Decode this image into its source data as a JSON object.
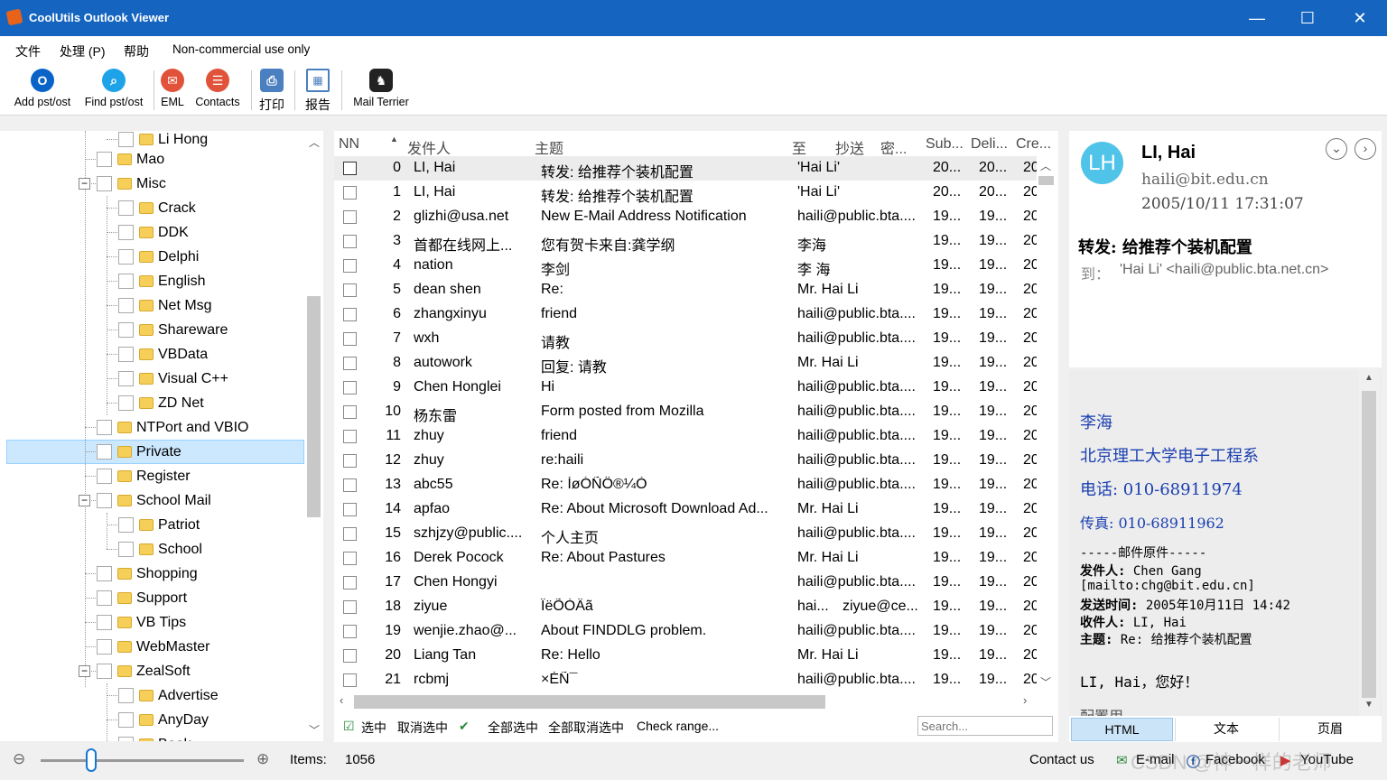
{
  "window": {
    "title": "CoolUtils Outlook Viewer",
    "min": "—",
    "max": "☐",
    "close": "✕"
  },
  "menu": [
    "文件",
    "处理 (P)",
    "帮助",
    "Non-commercial use only"
  ],
  "toolbar": [
    {
      "label": "Add pst/ost",
      "icon": "outlook-icon"
    },
    {
      "label": "Find pst/ost",
      "icon": "search-icon"
    },
    {
      "label": "EML",
      "icon": "email-icon"
    },
    {
      "label": "Contacts",
      "icon": "contacts-icon"
    },
    {
      "label": "打印",
      "icon": "print-icon"
    },
    {
      "label": "报告",
      "icon": "report-icon"
    },
    {
      "label": "Mail Terrier",
      "icon": "terrier-icon"
    }
  ],
  "tree": [
    {
      "label": "Li Hong"
    },
    {
      "label": "Mao"
    },
    {
      "label": "Misc",
      "expander": "−"
    },
    {
      "label": "Crack"
    },
    {
      "label": "DDK"
    },
    {
      "label": "Delphi"
    },
    {
      "label": "English"
    },
    {
      "label": "Net Msg"
    },
    {
      "label": "Shareware"
    },
    {
      "label": "VBData"
    },
    {
      "label": "Visual C++"
    },
    {
      "label": "ZD Net"
    },
    {
      "label": "NTPort and VBIO"
    },
    {
      "label": "Private",
      "selected": true
    },
    {
      "label": "Register"
    },
    {
      "label": "School Mail",
      "expander": "−"
    },
    {
      "label": "Patriot"
    },
    {
      "label": "School"
    },
    {
      "label": "Shopping"
    },
    {
      "label": "Support"
    },
    {
      "label": "VB Tips"
    },
    {
      "label": "WebMaster"
    },
    {
      "label": "ZealSoft",
      "expander": "−"
    },
    {
      "label": "Advertise"
    },
    {
      "label": "AnyDay"
    },
    {
      "label": "Book"
    }
  ],
  "list": {
    "headers": [
      "NN",
      "发件人",
      "主题",
      "至",
      "抄送",
      "密...",
      "Sub...",
      "Deli...",
      "Cre..."
    ],
    "rows": [
      [
        "0",
        "LI, Hai",
        "转发: 给推荐个装机配置",
        "'Hai Li'",
        "",
        "20...",
        "20...",
        "20"
      ],
      [
        "1",
        "LI, Hai",
        "转发: 给推荐个装机配置",
        "'Hai Li'",
        "",
        "20...",
        "20...",
        "20"
      ],
      [
        "2",
        "glizhi@usa.net",
        "New E-Mail Address Notification",
        "haili@public.bta....",
        "",
        "19...",
        "19...",
        "20"
      ],
      [
        "3",
        "首都在线网上...",
        "您有贺卡来自:龚学纲",
        "李海",
        "",
        "19...",
        "19...",
        "20"
      ],
      [
        "4",
        "nation",
        "李剑",
        "李 海",
        "",
        "19...",
        "19...",
        "20"
      ],
      [
        "5",
        "dean shen",
        "Re:",
        "Mr. Hai Li",
        "",
        "19...",
        "19...",
        "20"
      ],
      [
        "6",
        "zhangxinyu",
        "friend",
        "haili@public.bta....",
        "",
        "19...",
        "19...",
        "20"
      ],
      [
        "7",
        "wxh",
        "请教",
        "haili@public.bta....",
        "",
        "19...",
        "19...",
        "20"
      ],
      [
        "8",
        "autowork",
        "回复: 请教",
        "Mr. Hai Li",
        "",
        "19...",
        "19...",
        "20"
      ],
      [
        "9",
        "Chen Honglei",
        "Hi",
        "haili@public.bta....",
        "",
        "19...",
        "19...",
        "20"
      ],
      [
        "10",
        "杨东雷",
        "Form posted from Mozilla",
        "haili@public.bta....",
        "",
        "19...",
        "19...",
        "20"
      ],
      [
        "11",
        "zhuy",
        "friend",
        "haili@public.bta....",
        "",
        "19...",
        "19...",
        "20"
      ],
      [
        "12",
        "zhuy",
        "re:haili",
        "haili@public.bta....",
        "",
        "19...",
        "19...",
        "20"
      ],
      [
        "13",
        "abc55",
        "Re: ÍøÓÑÖ®¼Ò",
        "haili@public.bta....",
        "",
        "19...",
        "19...",
        "20"
      ],
      [
        "14",
        "apfao",
        "Re: About Microsoft Download Ad...",
        "Mr. Hai Li",
        "",
        "19...",
        "19...",
        "20"
      ],
      [
        "15",
        "szhjzy@public....",
        "个人主页",
        "haili@public.bta....",
        "",
        "19...",
        "19...",
        "20"
      ],
      [
        "16",
        "Derek Pocock",
        "Re: About Pastures",
        "Mr. Hai Li",
        "",
        "19...",
        "19...",
        "20"
      ],
      [
        "17",
        "Chen Hongyi",
        "",
        "haili@public.bta....",
        "",
        "19...",
        "19...",
        "20"
      ],
      [
        "18",
        "ziyue",
        "ÏëÕÒÄã",
        "hai...",
        "ziyue@ce...",
        "19...",
        "19...",
        "20"
      ],
      [
        "19",
        "wenjie.zhao@...",
        "About FINDDLG problem.",
        "haili@public.bta....",
        "",
        "19...",
        "19...",
        "20"
      ],
      [
        "20",
        "Liang Tan",
        "Re: Hello",
        "Mr. Hai Li",
        "",
        "19...",
        "19...",
        "20"
      ],
      [
        "21",
        "rcbmj",
        "×ÉÑ¯",
        "haili@public.bta....",
        "",
        "19...",
        "19...",
        "20"
      ]
    ],
    "selected_index": 0
  },
  "listbar": {
    "select": "选中",
    "deselect": "取消选中",
    "select_all": "全部选中",
    "deselect_all": "全部取消选中",
    "check_range": "Check range...",
    "search_placeholder": "Search..."
  },
  "reader": {
    "avatar": "LH",
    "name": "LI, Hai",
    "email": "haili@bit.edu.cn",
    "date": "2005/10/11 17:31:07",
    "subject": "转发: 给推荐个装机配置",
    "to_label": "到：",
    "to": "'Hai Li' <haili@public.bta.net.cn>",
    "body": {
      "sig_name": "李海",
      "sig_dept": "北京理工大学电子工程系",
      "sig_tel": "电话: 010-68911974",
      "sig_fax": "传真: 010-68911962",
      "orig_header": "-----邮件原件-----",
      "from_label": "发件人:",
      "from": "Chen Gang",
      "from_mailto": "[mailto:chg@bit.edu.cn]",
      "sent_label": "发送时间:",
      "sent": "2005年10月11日 14:42",
      "to_label": "收件人:",
      "to": "LI, Hai",
      "subj_label": "主题:",
      "subj": "Re: 给推荐个装机配置",
      "greeting": "LI, Hai，您好！",
      "cut_line": "  配置用..."
    },
    "tabs": [
      "HTML",
      "文本",
      "页眉"
    ]
  },
  "status": {
    "items_label": "Items:",
    "items": "1056",
    "contact": "Contact us",
    "email": "E-mail",
    "facebook": "Facebook",
    "youtube": "YouTube",
    "watermark": "CSDN @神一样的老师"
  },
  "colors": {
    "titlebar": "#1565c0",
    "selection": "#cce8ff",
    "link_blue": "#1a3fb0"
  }
}
